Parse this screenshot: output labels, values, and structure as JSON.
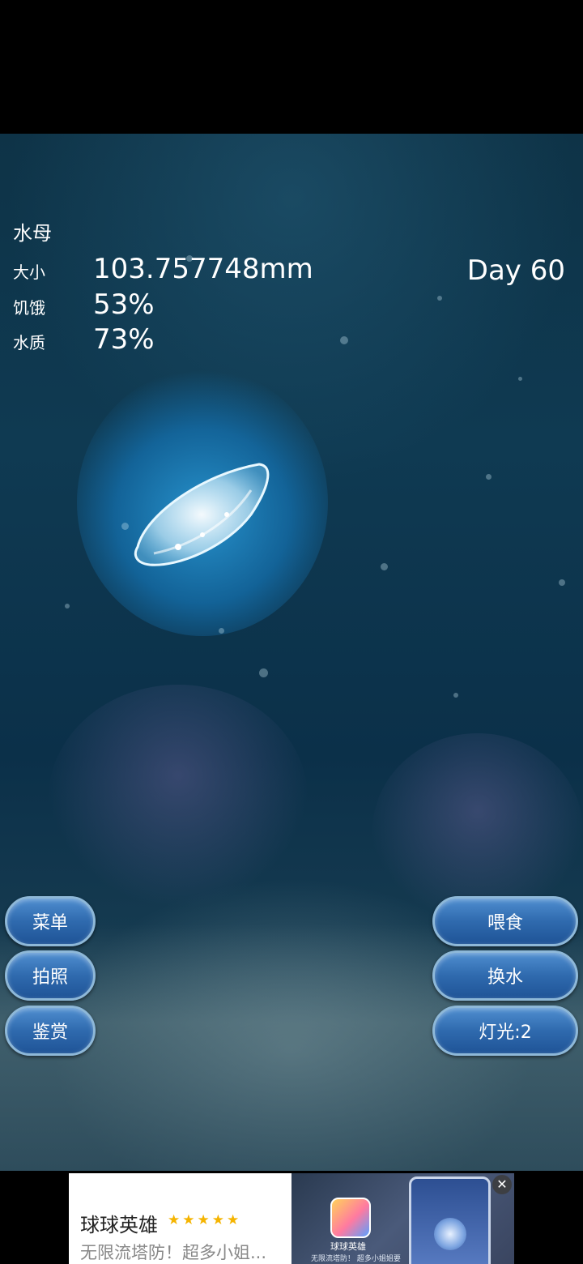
{
  "hud": {
    "title": "水母",
    "size_label": "大小",
    "size_value": "103.757748mm",
    "hunger_label": "饥饿",
    "hunger_value": "53%",
    "water_label": "水质",
    "water_value": "73%",
    "day": "Day 60"
  },
  "left_buttons": {
    "menu": "菜单",
    "photo": "拍照",
    "appreciate": "鉴赏"
  },
  "right_buttons": {
    "feed": "喂食",
    "change_water": "换水",
    "light": "灯光:2"
  },
  "ad": {
    "title": "球球英雄",
    "stars": "★★★★★",
    "description": "无限流塔防！超多小姐...",
    "app_name": "球球英雄",
    "app_desc": "无限流塔防！ 超多小姐姐要",
    "close_icon": "close-icon"
  },
  "colors": {
    "button_fill": "#2f6aae",
    "button_border": "#8eb8d8",
    "star": "#f5b400"
  }
}
